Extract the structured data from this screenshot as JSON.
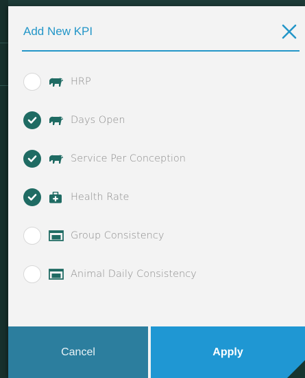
{
  "dialog": {
    "title": "Add New KPI",
    "close_label": "close",
    "accent_color": "#2396c8",
    "check_color": "#1f6b63"
  },
  "kpis": [
    {
      "label": "HRP",
      "icon": "cow-icon",
      "checked": false
    },
    {
      "label": "Days Open",
      "icon": "cow-icon",
      "checked": true
    },
    {
      "label": "Service Per Conception",
      "icon": "cow-icon",
      "checked": true
    },
    {
      "label": "Health Rate",
      "icon": "medical-kit-icon",
      "checked": true
    },
    {
      "label": "Group Consistency",
      "icon": "feed-bunk-icon",
      "checked": false
    },
    {
      "label": "Animal Daily Consistency",
      "icon": "feed-bunk-icon",
      "checked": false
    }
  ],
  "footer": {
    "cancel_label": "Cancel",
    "apply_label": "Apply"
  }
}
